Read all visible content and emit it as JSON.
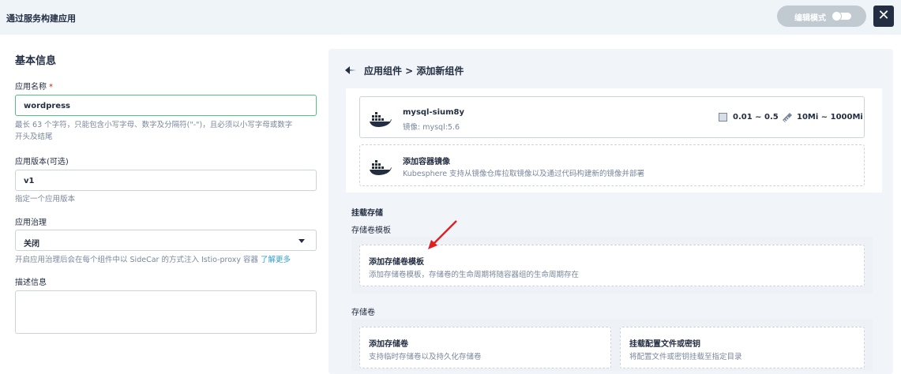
{
  "header": {
    "title": "通过服务构建应用",
    "edit_mode_label": "编辑模式",
    "close_symbol": "✕"
  },
  "form": {
    "section_title": "基本信息",
    "app_name_label": "应用名称",
    "required_mark": "*",
    "app_name_value": "wordpress",
    "app_name_hint_line1": "最长 63 个字符，只能包含小写字母、数字及分隔符(\"-\")，且必须以小写字母或数字",
    "app_name_hint_line2": "开头及结尾",
    "version_label": "应用版本(可选)",
    "version_value": "v1",
    "version_hint": "指定一个应用版本",
    "governance_label": "应用治理",
    "governance_value": "关闭",
    "governance_hint": "开启应用治理后会在每个组件中以 SideCar 的方式注入 Istio-proxy 容器",
    "governance_link": "了解更多",
    "description_label": "描述信息"
  },
  "component": {
    "breadcrumb": "应用组件 > 添加新组件",
    "container": {
      "name": "mysql-sium8y",
      "image": "镜像: mysql:5.6",
      "cpu": "0.01 ~ 0.5",
      "memory": "10Mi ~ 1000Mi"
    },
    "add_image": {
      "title": "添加容器镜像",
      "desc": "Kubesphere 支持从镜像仓库拉取镜像以及通过代码构建新的镜像并部署"
    },
    "mount_storage_title": "挂载存储",
    "volume_template_title": "存储卷模板",
    "add_volume_template": {
      "title": "添加存储卷模板",
      "desc": "添加存储卷模板，存储卷的生命周期将随容器组的生命周期存在"
    },
    "volume_title": "存储卷",
    "add_volume": {
      "title": "添加存储卷",
      "desc": "支持临时存储卷以及持久化存储卷"
    },
    "mount_config": {
      "title": "挂载配置文件或密钥",
      "desc": "将配置文件或密钥挂载至指定目录"
    }
  },
  "colors": {
    "accent_green": "#55bc8a",
    "dark": "#242e42",
    "link_blue": "#329dce",
    "arrow_red": "#e02020",
    "required_red": "#ca2621"
  }
}
